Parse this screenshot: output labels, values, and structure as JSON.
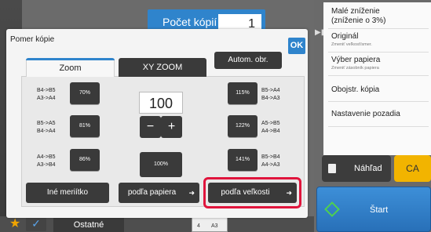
{
  "copies": {
    "label": "Počet kópií",
    "value": "1"
  },
  "right_panel": {
    "items": [
      {
        "label": "Malé zníženie\n(zníženie o 3%)",
        "sub": ""
      },
      {
        "label": "Originál",
        "sub": "Zmeniť veľkosť/smer."
      },
      {
        "label": "Výber papiera",
        "sub": "Zmeniť zásobník papiera"
      },
      {
        "label": "Obojstr. kópia",
        "sub": ""
      },
      {
        "label": "Nastavenie pozadia",
        "sub": ""
      }
    ],
    "preview_label": "Náhľad",
    "ca_label": "CA",
    "start_label": "Štart"
  },
  "bottom": {
    "ostatne": "Ostatné",
    "tray_top": "4",
    "tray_size": "A3"
  },
  "dialog": {
    "title": "Pomer kópie",
    "ok_label": "OK",
    "tabs": [
      {
        "label": "Zoom",
        "active": true
      },
      {
        "label": "XY ZOOM",
        "active": false
      }
    ],
    "autom_label": "Autom. obr.",
    "zoom_value": "100",
    "minus": "−",
    "plus": "+",
    "pct_100": "100%",
    "left_presets": [
      {
        "label": "70%",
        "sizes": "B4->B5\nA3->A4"
      },
      {
        "label": "81%",
        "sizes": "B5->A5\nB4->A4"
      },
      {
        "label": "86%",
        "sizes": "A4->B5\nA3->B4"
      }
    ],
    "right_presets": [
      {
        "label": "115%",
        "sizes": "B5->A4\nB4->A3"
      },
      {
        "label": "122%",
        "sizes": "A5->B5\nA4->B4"
      },
      {
        "label": "141%",
        "sizes": "B5->B4\nA4->A3"
      }
    ],
    "buttons": {
      "ine": "Iné meriítko",
      "papier": "podľa papiera",
      "velkost": "podľa veľkosti"
    }
  }
}
